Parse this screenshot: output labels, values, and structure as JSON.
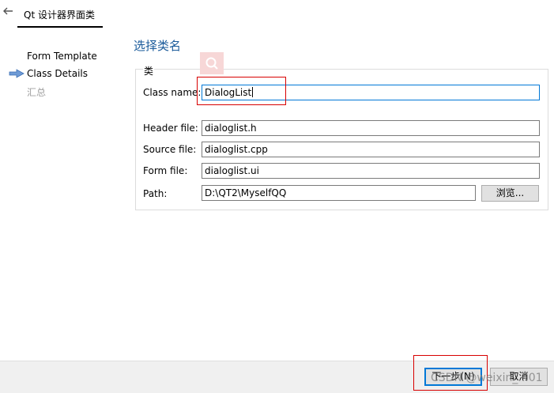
{
  "titlebar": {
    "title": "Qt 设计器界面类"
  },
  "steps": [
    {
      "label": "Form Template"
    },
    {
      "label": "Class Details"
    },
    {
      "label": "汇总"
    }
  ],
  "page": {
    "heading": "选择类名"
  },
  "group": {
    "title": "类",
    "class_name_label": "Class name:",
    "class_name_value": "DialogList",
    "header_label": "Header file:",
    "header_value": "dialoglist.h",
    "source_label": "Source file:",
    "source_value": "dialoglist.cpp",
    "form_label": "Form file:",
    "form_value": "dialoglist.ui",
    "path_label": "Path:",
    "path_value": "D:\\QT2\\MyselfQQ",
    "browse_label": "浏览..."
  },
  "footer": {
    "next_label": "下一步(N)",
    "cancel_label": "取消"
  },
  "watermark": "CSDN @weixin_...01",
  "colors": {
    "accent": "#0078d7",
    "heading": "#1a5a9a",
    "annotation": "#d80000"
  }
}
